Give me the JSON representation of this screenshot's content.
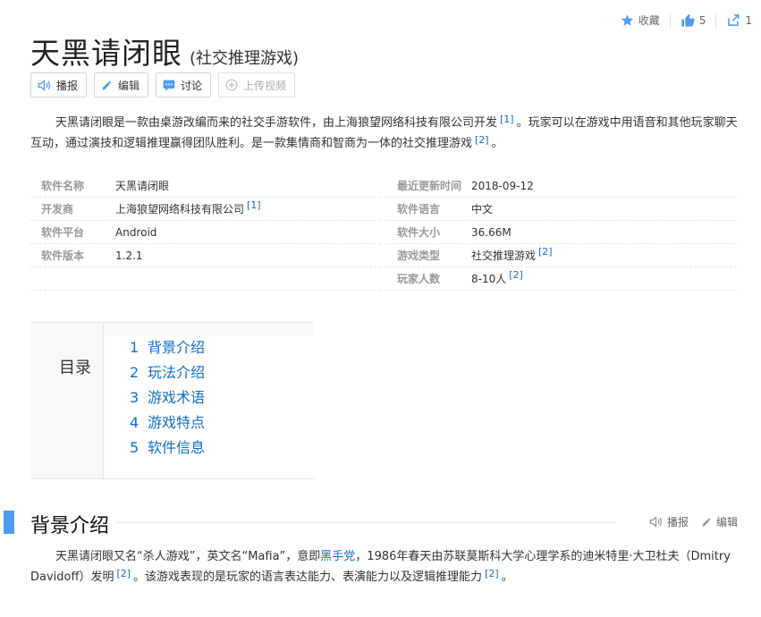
{
  "header": {
    "collect_label": "收藏",
    "like_count": "5",
    "share_count": "1",
    "colors": {
      "accent": "#136ec2",
      "icon": "#4f9cee"
    }
  },
  "title": {
    "main": "天黑请闭眼",
    "sub": "(社交推理游戏)"
  },
  "tools": {
    "play": "播报",
    "edit": "编辑",
    "discuss": "讨论",
    "upload": "上传视频"
  },
  "summary": {
    "p1": "天黑请闭眼是一款由桌游改编而来的社交手游软件，由上海狼望网络科技有限公司开发",
    "ref1": "[1]",
    "p2": "。玩家可以在游戏中用语音和其他玩家聊天互动，通过演技和逻辑推理赢得团队胜利。是一款集情商和智商为一体的社交推理游戏",
    "ref2": "[2]",
    "p3": "。"
  },
  "basic_info": {
    "left": [
      {
        "key": "软件名称",
        "value": "天黑请闭眼",
        "ref": ""
      },
      {
        "key": "开发商",
        "value": "上海狼望网络科技有限公司",
        "ref": "[1]"
      },
      {
        "key": "软件平台",
        "value": "Android",
        "ref": ""
      },
      {
        "key": "软件版本",
        "value": "1.2.1",
        "ref": ""
      }
    ],
    "right": [
      {
        "key": "最近更新时间",
        "value": "2018-09-12",
        "ref": ""
      },
      {
        "key": "软件语言",
        "value": "中文",
        "ref": ""
      },
      {
        "key": "软件大小",
        "value": "36.66M",
        "ref": ""
      },
      {
        "key": "游戏类型",
        "value": "社交推理游戏",
        "ref": "[2]"
      },
      {
        "key": "玩家人数",
        "value": "8-10人",
        "ref": "[2]"
      }
    ]
  },
  "toc": {
    "label": "目录",
    "items": [
      {
        "num": "1",
        "text": "背景介绍"
      },
      {
        "num": "2",
        "text": "玩法介绍"
      },
      {
        "num": "3",
        "text": "游戏术语"
      },
      {
        "num": "4",
        "text": "游戏特点"
      },
      {
        "num": "5",
        "text": "软件信息"
      }
    ]
  },
  "section1": {
    "title": "背景介绍",
    "play": "播报",
    "edit": "编辑",
    "t1": "天黑请闭眼又名“杀人游戏”，英文名“Mafia”，意即",
    "link": "黑手党",
    "t2": "，1986年春天由苏联莫斯科大学心理学系的迪米特里·大卫杜夫（Dmitry Davidoff）发明",
    "ref": "[2]",
    "t3": "。该游戏表现的是玩家的语言表达能力、表演能力以及逻辑推理能力",
    "ref2": "[2]",
    "t4": "。"
  }
}
